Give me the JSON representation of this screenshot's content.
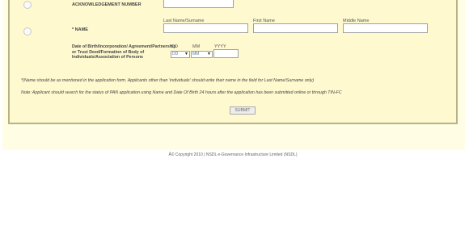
{
  "form": {
    "ack_label": "ACKNOWLEDGEMENT NUMBER",
    "name_label": "* NAME",
    "last_name_header": "Last Name/Surname",
    "first_name_header": "First Name",
    "middle_name_header": "Middle Name",
    "dob_label": "Date of Birth/Incorporation/ Agreement/Partnership or Trust Deed/Formation of Body of Individuals/Association of Persons",
    "dd_header": "DD",
    "mm_header": "MM",
    "yyyy_header": "YYYY",
    "dd_value": "DD",
    "mm_value": "MM",
    "arrow": "▼",
    "name_note": "*(Name should be as mentioned in the application form. Applicants other than 'individuals' should write their name in the field for Last Name/Surname only)",
    "search_note": "Note: Applicant should search for the status of PAN application using Name and Date Of Birth 24 hours after the application has been submitted online or through TIN-FC",
    "submit_label": "SUBMIT"
  },
  "footer": {
    "copyright": "Â© Copyright 2010 | NSDL e-Governance Infrastructure Limited (NSDL)"
  }
}
